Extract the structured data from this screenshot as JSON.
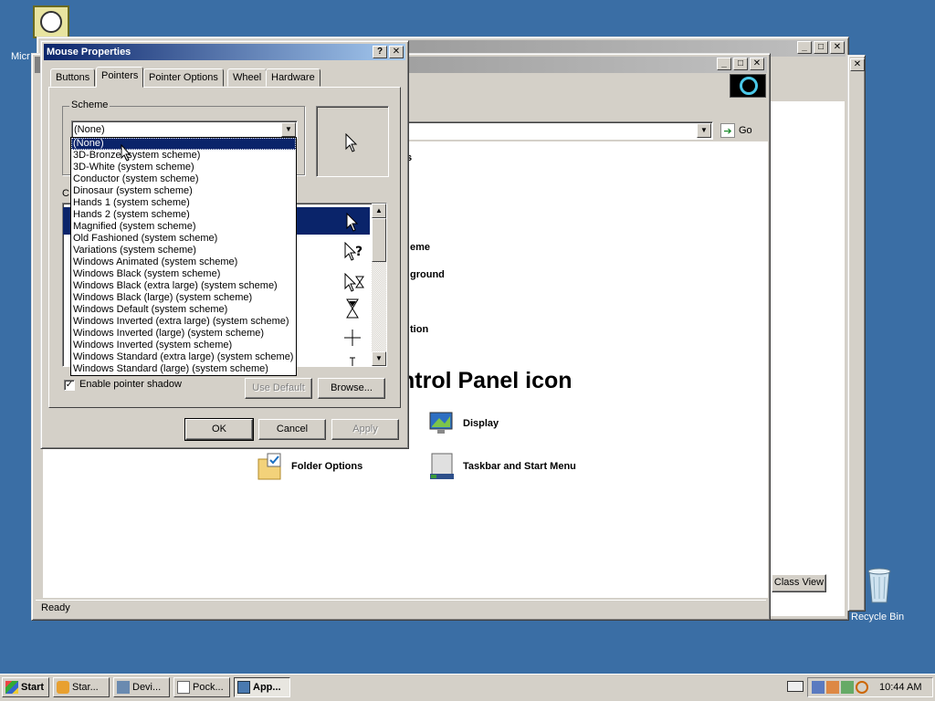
{
  "desktop": {
    "top_left_icon_label": "Micr",
    "recycle_bin_label": "Recycle Bin"
  },
  "back_window": {
    "title": "",
    "address_go": "Go",
    "heading": "ntrol Panel icon",
    "partial_items": [
      "s",
      "eme",
      "ground",
      "tion"
    ],
    "items": [
      {
        "label": "Display",
        "icon": "display-icon"
      },
      {
        "label": "Folder Options",
        "icon": "folder-options-icon"
      },
      {
        "label": "Taskbar and Start Menu",
        "icon": "taskbar-icon"
      }
    ],
    "class_view_label": "Class View",
    "status": "Ready"
  },
  "dialog": {
    "title": "Mouse Properties",
    "tabs": [
      "Buttons",
      "Pointers",
      "Pointer Options",
      "Wheel",
      "Hardware"
    ],
    "selected_tab": "Pointers",
    "scheme_label": "Scheme",
    "scheme_value": "(None)",
    "customize_label": "C",
    "scheme_options": [
      "(None)",
      "3D-Bronze (system scheme)",
      "3D-White (system scheme)",
      "Conductor (system scheme)",
      "Dinosaur (system scheme)",
      "Hands 1 (system scheme)",
      "Hands 2 (system scheme)",
      "Magnified (system scheme)",
      "Old Fashioned (system scheme)",
      "Variations (system scheme)",
      "Windows Animated (system scheme)",
      "Windows Black  (system scheme)",
      "Windows Black (extra large) (system scheme)",
      "Windows Black (large) (system scheme)",
      "Windows Default (system scheme)",
      "Windows Inverted (extra large) (system scheme)",
      "Windows Inverted (large) (system scheme)",
      "Windows Inverted (system scheme)",
      "Windows Standard (extra large) (system scheme)",
      "Windows Standard (large) (system scheme)"
    ],
    "pointer_shadow_label": "Enable pointer shadow",
    "pointer_shadow_checked": true,
    "use_default_label": "Use Default",
    "browse_label": "Browse...",
    "ok_label": "OK",
    "cancel_label": "Cancel",
    "apply_label": "Apply",
    "help_button": "?",
    "close_button": "X"
  },
  "taskbar": {
    "start_label": "Start",
    "tasks": [
      {
        "label": "Star...",
        "active": false
      },
      {
        "label": "Devi...",
        "active": false
      },
      {
        "label": "Pock...",
        "active": false
      },
      {
        "label": "App...",
        "active": true
      }
    ],
    "clock": "10:44 AM"
  },
  "colors": {
    "desktop": "#3a6ea5",
    "title_active": "#0a246a",
    "face": "#d4d0c8"
  }
}
